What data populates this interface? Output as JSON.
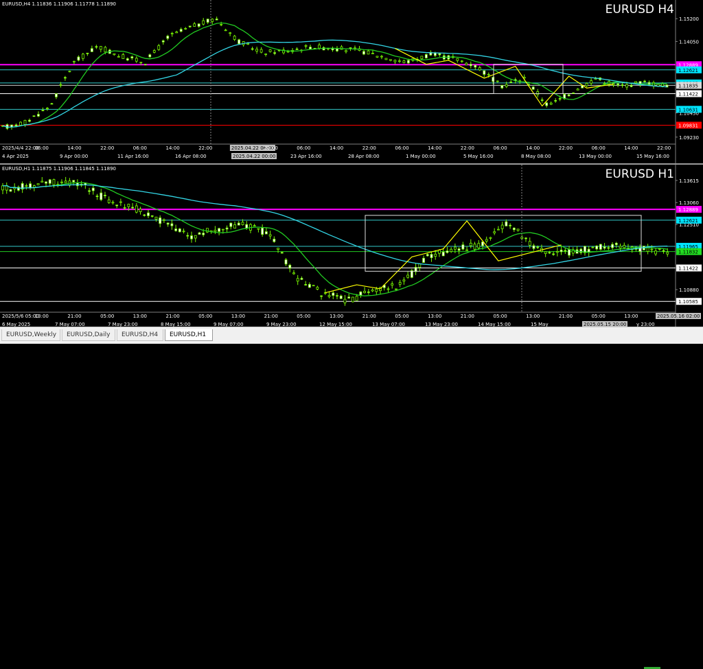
{
  "h4": {
    "ohlc": "EURUSD,H4  1.11836 1.11906 1.11778 1.11890",
    "title": "EURUSD H4",
    "price_levels": [
      {
        "text": "1.15200",
        "value": 1.152
      },
      {
        "text": "1.14050",
        "value": 1.1405
      },
      {
        "text": "1.10450",
        "value": 1.1045
      },
      {
        "text": "1.09230",
        "value": 1.0923
      }
    ],
    "hlines": [
      {
        "value": 1.1288,
        "label": "1.12889",
        "color": "#ff00ff",
        "label_bg": "#ff00ff",
        "label_fg": "#ffffff"
      },
      {
        "value": 1.1262,
        "label": "1.12621",
        "color": "#33cccc",
        "label_bg": "#00e5ff",
        "label_fg": "#000000"
      },
      {
        "value": 1.1196,
        "label": "1.11965",
        "color": "#33cccc",
        "label_bg": "#00e5ff",
        "label_fg": "#000000"
      },
      {
        "value": 1.1184,
        "label": "1.11835",
        "color": "#cccccc",
        "label_bg": "#d9d9d9",
        "label_fg": "#000000"
      },
      {
        "value": 1.1142,
        "label": "1.11422",
        "color": "#ffffff",
        "label_bg": "#ffffff",
        "label_fg": "#000000"
      },
      {
        "value": 1.1063,
        "label": "1.10631",
        "color": "#33cccc",
        "label_bg": "#00e5ff",
        "label_fg": "#000000"
      },
      {
        "value": 1.0983,
        "label": "1.09831",
        "color": "#ff0000",
        "label_bg": "#ff0000",
        "label_fg": "#ffffff"
      }
    ],
    "time_labels": [
      "2025/4/4 22:00",
      "06:00",
      "14:00",
      "22:00",
      "06:00",
      "14:00",
      "22:00",
      "2025.04.22 06:00",
      "22:00",
      "06:00",
      "14:00",
      "22:00",
      "06:00",
      "14:00",
      "22:00",
      "06:00",
      "14:00",
      "22:00",
      "06:00",
      "14:00",
      "22:00"
    ],
    "date_labels": [
      "4 Apr 2025",
      "9 Apr 00:00",
      "11 Apr 16:00",
      "16 Apr 08:00",
      "2025.04.22 00:00",
      "23 Apr 16:00",
      "28 Apr 08:00",
      "1 May 00:00",
      "5 May 16:00",
      "8 May 08:00",
      "13 May 00:00",
      "15 May 16:00"
    ]
  },
  "h1": {
    "ohlc": "EURUSD,H1  1.11875 1.11906 1.11845 1.11890",
    "title": "EURUSD H1",
    "price_levels": [
      {
        "text": "1.13615",
        "value": 1.13615
      },
      {
        "text": "1.13060",
        "value": 1.1306
      },
      {
        "text": "1.12510",
        "value": 1.1251
      },
      {
        "text": "1.10880",
        "value": 1.1088
      }
    ],
    "hlines": [
      {
        "value": 1.1289,
        "label": "1.12889",
        "color": "#ff00ff",
        "label_bg": "#ff00ff",
        "label_fg": "#ffffff"
      },
      {
        "value": 1.1262,
        "label": "1.12621",
        "color": "#33cccc",
        "label_bg": "#00e5ff",
        "label_fg": "#000000"
      },
      {
        "value": 1.11965,
        "label": "1.11965",
        "color": "#33cccc",
        "label_bg": "#00e5ff",
        "label_fg": "#000000"
      },
      {
        "value": 1.11832,
        "label": "1.11832",
        "color": "#22cc22",
        "label_bg": "#22dd22",
        "label_fg": "#000000"
      },
      {
        "value": 1.11422,
        "label": "1.11422",
        "color": "#ffffff",
        "label_bg": "#ffffff",
        "label_fg": "#000000"
      },
      {
        "value": 1.10585,
        "label": "1.10585",
        "color": "#ffffff",
        "label_bg": "#ffffff",
        "label_fg": "#000000"
      }
    ],
    "time_labels": [
      "2025/5/6 05:00",
      "13:00",
      "21:00",
      "05:00",
      "13:00",
      "21:00",
      "05:00",
      "13:00",
      "21:00",
      "05:00",
      "13:00",
      "21:00",
      "05:00",
      "13:00",
      "21:00",
      "05:00",
      "13:00",
      "21:00",
      "05:00",
      "13:00",
      "2025.05.16 02:00"
    ],
    "date_labels": [
      "6 May 2025",
      "7 May 07:00",
      "7 May 23:00",
      "8 May 15:00",
      "9 May 07:00",
      "9 May 23:00",
      "12 May 15:00",
      "13 May 07:00",
      "13 May 23:00",
      "14 May 15:00",
      "15 May",
      "2025.05.15 20:00",
      "y 23:00"
    ]
  },
  "tabs": [
    {
      "label": "EURUSD,Weekly",
      "active": false
    },
    {
      "label": "EURUSD,Daily",
      "active": false
    },
    {
      "label": "EURUSD,H4",
      "active": false
    },
    {
      "label": "EURUSD,H1",
      "active": true
    }
  ],
  "colors": {
    "candle": "#7cfc00",
    "ma_fast": "#22cc22",
    "ma_slow": "#33d6e6",
    "zigzag": "#ffff00"
  }
}
